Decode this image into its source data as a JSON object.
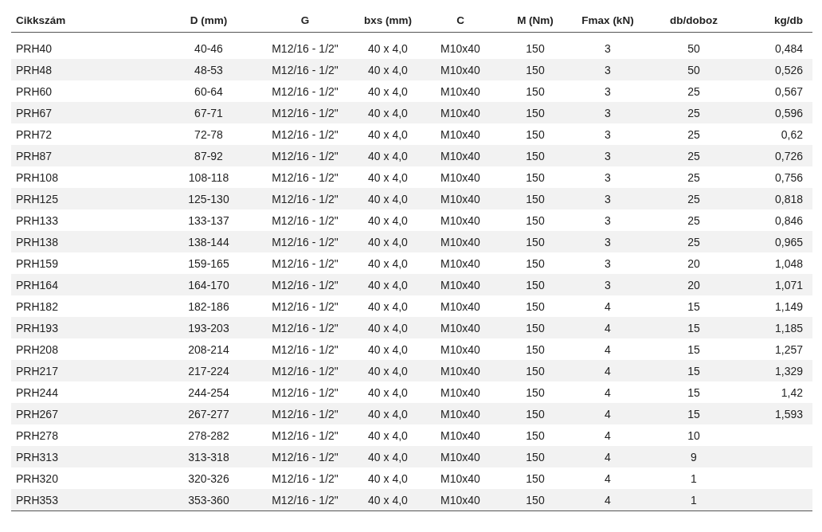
{
  "table": {
    "columns": [
      "Cikkszám",
      "D (mm)",
      "G",
      "bxs (mm)",
      "C",
      "M (Nm)",
      "Fmax (kN)",
      "db/doboz",
      "kg/db"
    ],
    "rows": [
      [
        "PRH40",
        "40-46",
        "M12/16 - 1/2\"",
        "40 x 4,0",
        "M10x40",
        "150",
        "3",
        "50",
        "0,484"
      ],
      [
        "PRH48",
        "48-53",
        "M12/16 - 1/2\"",
        "40 x 4,0",
        "M10x40",
        "150",
        "3",
        "50",
        "0,526"
      ],
      [
        "PRH60",
        "60-64",
        "M12/16 - 1/2\"",
        "40 x 4,0",
        "M10x40",
        "150",
        "3",
        "25",
        "0,567"
      ],
      [
        "PRH67",
        "67-71",
        "M12/16 - 1/2\"",
        "40 x 4,0",
        "M10x40",
        "150",
        "3",
        "25",
        "0,596"
      ],
      [
        "PRH72",
        "72-78",
        "M12/16 - 1/2\"",
        "40 x 4,0",
        "M10x40",
        "150",
        "3",
        "25",
        "0,62"
      ],
      [
        "PRH87",
        "87-92",
        "M12/16 - 1/2\"",
        "40 x 4,0",
        "M10x40",
        "150",
        "3",
        "25",
        "0,726"
      ],
      [
        "PRH108",
        "108-118",
        "M12/16 - 1/2\"",
        "40 x 4,0",
        "M10x40",
        "150",
        "3",
        "25",
        "0,756"
      ],
      [
        "PRH125",
        "125-130",
        "M12/16 - 1/2\"",
        "40 x 4,0",
        "M10x40",
        "150",
        "3",
        "25",
        "0,818"
      ],
      [
        "PRH133",
        "133-137",
        "M12/16 - 1/2\"",
        "40 x 4,0",
        "M10x40",
        "150",
        "3",
        "25",
        "0,846"
      ],
      [
        "PRH138",
        "138-144",
        "M12/16 - 1/2\"",
        "40 x 4,0",
        "M10x40",
        "150",
        "3",
        "25",
        "0,965"
      ],
      [
        "PRH159",
        "159-165",
        "M12/16 - 1/2\"",
        "40 x 4,0",
        "M10x40",
        "150",
        "3",
        "20",
        "1,048"
      ],
      [
        "PRH164",
        "164-170",
        "M12/16 - 1/2\"",
        "40 x 4,0",
        "M10x40",
        "150",
        "3",
        "20",
        "1,071"
      ],
      [
        "PRH182",
        "182-186",
        "M12/16 - 1/2\"",
        "40 x 4,0",
        "M10x40",
        "150",
        "4",
        "15",
        "1,149"
      ],
      [
        "PRH193",
        "193-203",
        "M12/16 - 1/2\"",
        "40 x 4,0",
        "M10x40",
        "150",
        "4",
        "15",
        "1,185"
      ],
      [
        "PRH208",
        "208-214",
        "M12/16 - 1/2\"",
        "40 x 4,0",
        "M10x40",
        "150",
        "4",
        "15",
        "1,257"
      ],
      [
        "PRH217",
        "217-224",
        "M12/16 - 1/2\"",
        "40 x 4,0",
        "M10x40",
        "150",
        "4",
        "15",
        "1,329"
      ],
      [
        "PRH244",
        "244-254",
        "M12/16 - 1/2\"",
        "40 x 4,0",
        "M10x40",
        "150",
        "4",
        "15",
        "1,42"
      ],
      [
        "PRH267",
        "267-277",
        "M12/16 - 1/2\"",
        "40 x 4,0",
        "M10x40",
        "150",
        "4",
        "15",
        "1,593"
      ],
      [
        "PRH278",
        "278-282",
        "M12/16 - 1/2\"",
        "40 x 4,0",
        "M10x40",
        "150",
        "4",
        "10"
      ],
      [
        "PRH313",
        "313-318",
        "M12/16 - 1/2\"",
        "40 x 4,0",
        "M10x40",
        "150",
        "4",
        "9"
      ],
      [
        "PRH320",
        "320-326",
        "M12/16 - 1/2\"",
        "40 x 4,0",
        "M10x40",
        "150",
        "4",
        "1"
      ],
      [
        "PRH353",
        "353-360",
        "M12/16 - 1/2\"",
        "40 x 4,0",
        "M10x40",
        "150",
        "4",
        "1"
      ]
    ]
  }
}
